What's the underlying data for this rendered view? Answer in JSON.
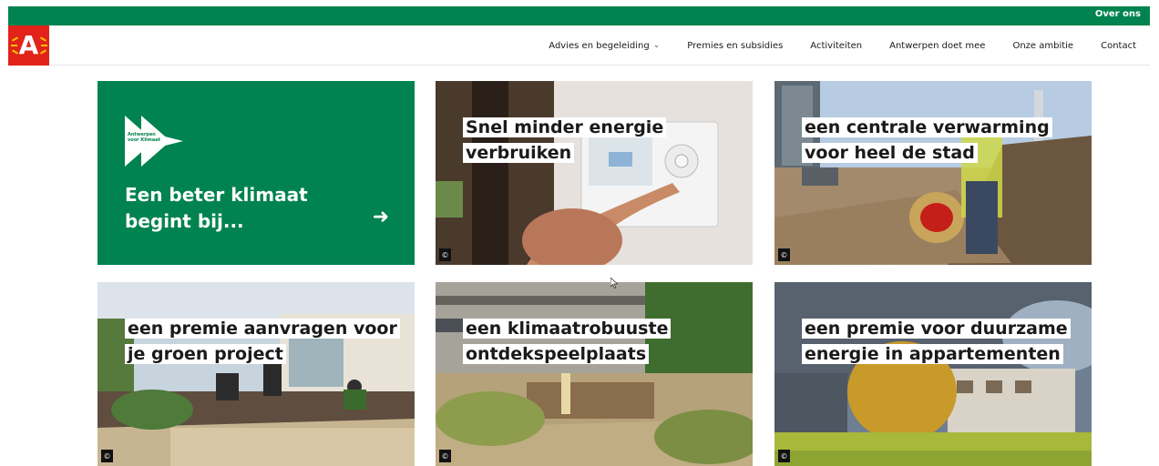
{
  "topbar": {
    "link": "Over ons"
  },
  "logo": {
    "letter": "A"
  },
  "nav": {
    "items": [
      {
        "label": "Advies en begeleiding"
      },
      {
        "label": "Premies en subsidies"
      },
      {
        "label": "Activiteiten"
      },
      {
        "label": "Antwerpen doet mee"
      },
      {
        "label": "Onze ambitie"
      },
      {
        "label": "Contact"
      }
    ]
  },
  "promo": {
    "badge_line1": "Antwerpen",
    "badge_line2": "voor Klimaat",
    "title": "Een beter klimaat begint bij...",
    "arrow_icon": "arrow-right-icon"
  },
  "tiles": [
    {
      "line1": "Snel minder energie",
      "line2": "verbruiken",
      "copyright": "©"
    },
    {
      "line1": "een centrale verwarming",
      "line2": "voor heel de stad",
      "copyright": "©"
    },
    {
      "line1": "een premie aanvragen voor",
      "line2": "je groen project",
      "copyright": "©"
    },
    {
      "line1": "een klimaatrobuuste",
      "line2": "ontdekspeelplaats",
      "copyright": "©"
    },
    {
      "line1": "een premie voor duurzame",
      "line2": "energie in appartementen",
      "copyright": "©"
    }
  ],
  "colors": {
    "brand_green": "#00834f",
    "brand_red": "#e2231a",
    "brand_yellow": "#f6c400"
  }
}
